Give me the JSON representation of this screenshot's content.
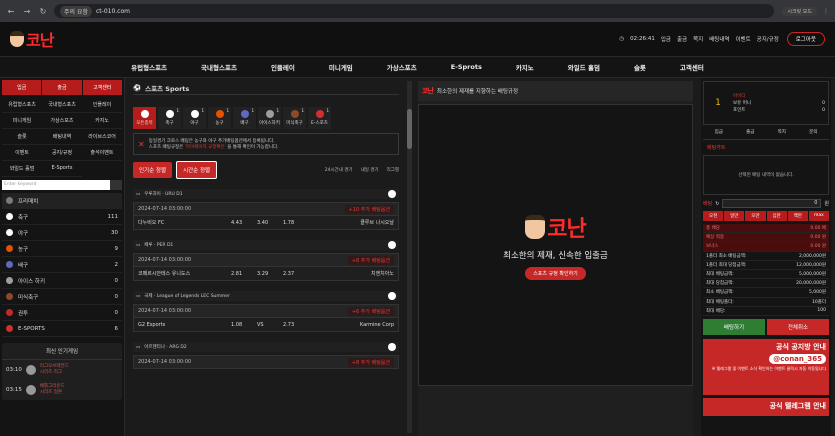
{
  "browser": {
    "warning": "주의 요함",
    "url": "ct-010.com",
    "secret_label": "시크릿 모드"
  },
  "header": {
    "logo": "코난",
    "time": "02:26:41",
    "links": [
      "입금",
      "출금",
      "쪽지",
      "배팅내역",
      "이벤트",
      "공지/규정"
    ],
    "logout": "로그아웃"
  },
  "nav": [
    "유럽형스포츠",
    "국내형스포츠",
    "인플레이",
    "미니게임",
    "가상스포츠",
    "E-Sprots",
    "카지노",
    "와일드 홀덤",
    "슬롯",
    "고객센터"
  ],
  "left": {
    "top_buttons": [
      "입금",
      "출금",
      "고객센터"
    ],
    "menu": [
      "유럽형스포츠",
      "국내형스포츠",
      "인플레이",
      "미니게임",
      "가상스포츠",
      "카지노",
      "슬롯",
      "배팅내역",
      "라이브스코어",
      "이벤트",
      "공지/규정",
      "출석이벤트",
      "와일드 홀덤",
      "E-Sports"
    ],
    "search_placeholder": "Enter keyword",
    "sports": [
      {
        "name": "프리매치",
        "count": "",
        "color": "#7a7a7a"
      },
      {
        "name": "축구",
        "count": "111",
        "color": "#ffffff"
      },
      {
        "name": "야구",
        "count": "30",
        "color": "#ffffff"
      },
      {
        "name": "농구",
        "count": "9",
        "color": "#e65100"
      },
      {
        "name": "배구",
        "count": "2",
        "color": "#5c6bc0"
      },
      {
        "name": "아이스 하키",
        "count": "0",
        "color": "#9e9e9e"
      },
      {
        "name": "미식축구",
        "count": "0",
        "color": "#8d4a2a"
      },
      {
        "name": "권투",
        "count": "0",
        "color": "#c62828"
      },
      {
        "name": "E-SPORTS",
        "count": "6",
        "color": "#d32f2f"
      }
    ],
    "popular_title": "최신 인기게임",
    "popular": [
      {
        "time": "03:10",
        "teams": "리그오브레전드\n시리즈 리그"
      },
      {
        "time": "03:15",
        "teams": "배틀그라운드\n시리즈 일본"
      }
    ]
  },
  "center": {
    "title": "스포츠 Sports",
    "icons": [
      {
        "label": "모든종목",
        "count": "",
        "color": "#ffffff"
      },
      {
        "label": "축구",
        "count": "1",
        "color": "#ffffff"
      },
      {
        "label": "야구",
        "count": "1",
        "color": "#ffffff"
      },
      {
        "label": "농구",
        "count": "1",
        "color": "#e65100"
      },
      {
        "label": "배구",
        "count": "1",
        "color": "#5c6bc0"
      },
      {
        "label": "아이스하키",
        "count": "1",
        "color": "#9e9e9e"
      },
      {
        "label": "미식축구",
        "count": "1",
        "color": "#8d4a2a"
      },
      {
        "label": "E-스포츠",
        "count": "1",
        "color": "#d32f2f"
      }
    ],
    "notice1": "동일경기 크로스 배팅은 농구와 야구 추가배팅옵션에서 등록됩니다.",
    "notice2a": "스포츠 배팅규정은 ",
    "notice2b": "'마이페이지 규정확인'",
    "notice2c": " 을 통해 확인이 가능합니다.",
    "sort1": "인기순 정렬",
    "sort2": "시간순 정렬",
    "filters": [
      "24시간내 경기",
      "내일 경기",
      "리그별"
    ],
    "matches": [
      {
        "league": "우루과이 · URU D1",
        "time": "2024-07-14 03:00:00",
        "more": "+10 추가 배팅옵션",
        "home": "다누비오 FC",
        "h": "4.43",
        "d": "3.40",
        "a": "1.78",
        "away": "클루브 나시오날"
      },
      {
        "league": "페루 · PER D1",
        "time": "2024-07-14 03:00:00",
        "more": "+8 추가 배팅옵션",
        "home": "코페르시안테스 유니도스",
        "h": "2.81",
        "d": "3.29",
        "a": "2.37",
        "away": "치엔치아노"
      },
      {
        "league": "국제 · League of Legends LEC Summer",
        "time": "2024-07-14 03:00:00",
        "more": "+6 추가 배팅옵션",
        "home": "G2 Esports",
        "h": "1.08",
        "d": "VS",
        "a": "2.73",
        "away": "Karmine Corp"
      },
      {
        "league": "아르헨티나 · ARG D2",
        "time": "2024-07-14 03:00:00",
        "more": "+8 추가 배팅옵션",
        "home": "",
        "h": "",
        "d": "",
        "a": "",
        "away": ""
      }
    ]
  },
  "banner": {
    "title": "최소한의 제재를 지향하는 배팅규정",
    "logo": "코난",
    "slogan": "최소한의 제재, 신속한 입출금",
    "go": "스포츠 규정 확인하기"
  },
  "right": {
    "user_name": "아이디",
    "user_rows": [
      {
        "label": "보유 머니",
        "value": "0"
      },
      {
        "label": "포인트",
        "value": "0"
      }
    ],
    "links": [
      "입금",
      "출금",
      "쪽지",
      "문의"
    ],
    "bet_cart": "배팅카트",
    "empty": "선택된 배팅 내역이 없습니다.",
    "amount_label": "배팅",
    "amount_value": "0",
    "amount_unit": "원",
    "chips": [
      "오천",
      "일만",
      "오만",
      "십만",
      "백만",
      "max"
    ],
    "rows": [
      {
        "label": "총 배당",
        "value": "0.00 배"
      },
      {
        "label": "예상 적중",
        "value": "0.00 원"
      },
      {
        "label": "보너스",
        "value": "0.00 원"
      },
      {
        "label": "1폴더 최소 배팅금액:",
        "value": "2,000,000원"
      },
      {
        "label": "1폴더 최대 당첨금액:",
        "value": "12,000,000원"
      },
      {
        "label": "최대 배팅금액:",
        "value": "5,000,000원"
      },
      {
        "label": "최대 당첨금액:",
        "value": "20,000,000원"
      },
      {
        "label": "최소 배팅금액:",
        "value": "5,000원"
      },
      {
        "label": "최대 배팅폴더:",
        "value": "10폴더"
      },
      {
        "label": "최대 배당:",
        "value": "100"
      }
    ],
    "btn_bet": "배팅하기",
    "btn_cancel": "전체취소",
    "promo_title": "공식 공지방 안내",
    "promo_tag": "@conan_365",
    "promo_sub": "※ 텔레그램 및 이벤트 소식 확인하는 이벤트 클릭시 자동 이동됩니다",
    "promo2": "공식 텔레그램 안내"
  }
}
